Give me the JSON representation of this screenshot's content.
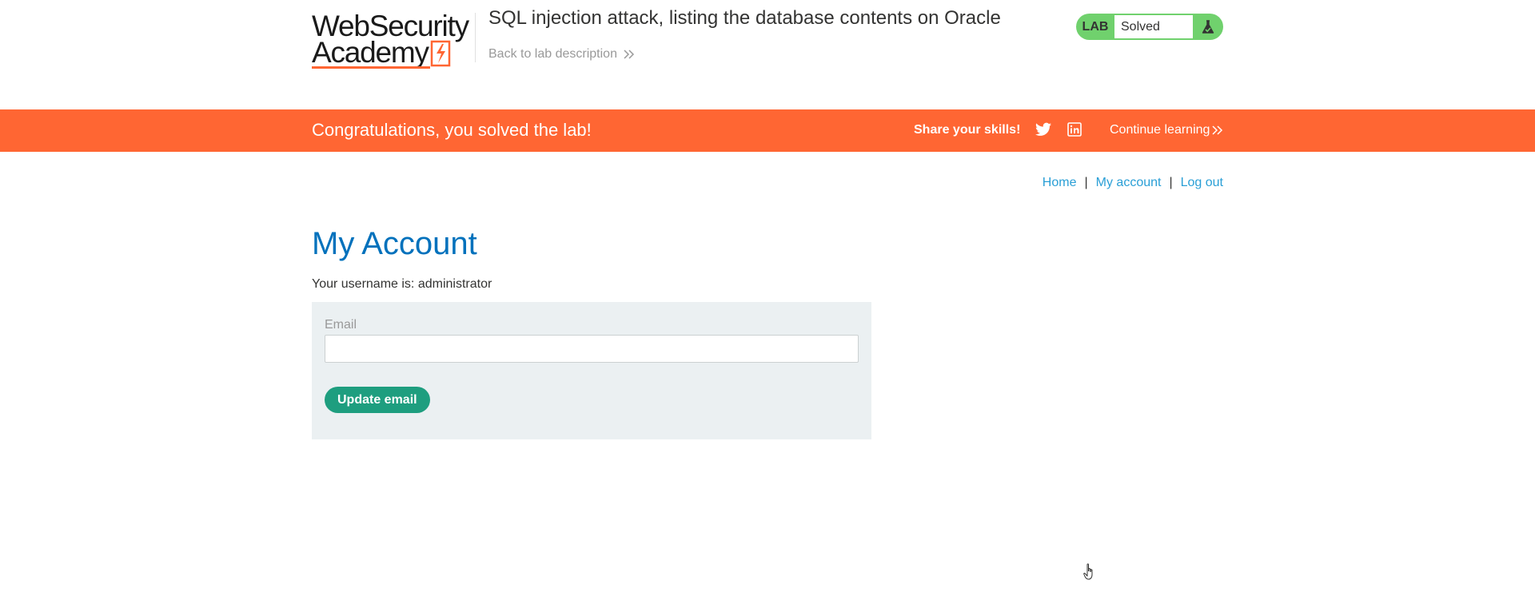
{
  "header": {
    "logo_line1": "WebSecurity",
    "logo_line2": "Academy",
    "lab_title": "SQL injection attack, listing the database contents on Oracle",
    "back_link": "Back to lab description",
    "lab_tag": "LAB",
    "lab_state": "Solved"
  },
  "banner": {
    "message": "Congratulations, you solved the lab!",
    "share": "Share your skills!",
    "continue": "Continue learning"
  },
  "nav": {
    "home": "Home",
    "sep1": "|",
    "my_account": "My account",
    "sep2": "|",
    "logout": "Log out"
  },
  "main": {
    "title": "My Account",
    "username_text": "Your username is: administrator",
    "email_label": "Email",
    "email_value": "",
    "update_button": "Update email"
  },
  "colors": {
    "accent_orange": "#ff6633",
    "lab_green": "#70d16d",
    "title_blue": "#0071bc",
    "link_blue": "#2a9fd6",
    "button_green": "#1e9e7f",
    "form_bg": "#ebf0f2"
  },
  "icons": [
    "bolt-icon",
    "chevron-double-right-icon",
    "flask-icon",
    "twitter-icon",
    "linkedin-icon",
    "hand-pointer-icon"
  ]
}
